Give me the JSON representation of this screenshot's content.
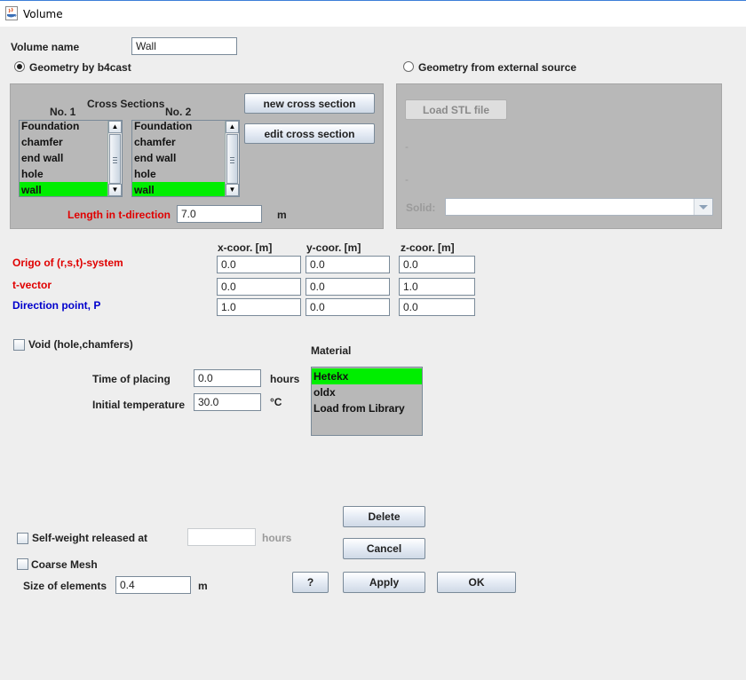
{
  "window": {
    "title": "Volume",
    "icon": "java-coffee-icon"
  },
  "volume_name": {
    "label": "Volume name",
    "value": "Wall"
  },
  "geometry": {
    "b4cast_label": "Geometry by b4cast",
    "external_label": "Geometry from external source",
    "selected": "b4cast"
  },
  "cross_sections": {
    "title": "Cross Sections",
    "list1": {
      "label": "No. 1",
      "items": [
        "Foundation",
        "chamfer",
        "end wall",
        "hole",
        "wall"
      ],
      "selected": 4
    },
    "list2": {
      "label": "No. 2",
      "items": [
        "Foundation",
        "chamfer",
        "end wall",
        "hole",
        "wall"
      ],
      "selected": 4
    },
    "new_button": "new cross section",
    "edit_button": "edit cross section",
    "length_label": "Length in t-direction",
    "length_value": "7.0",
    "length_unit": "m"
  },
  "external": {
    "load_button": "Load STL file",
    "dash1": "-",
    "dash2": "-",
    "solid_label": "Solid:",
    "solid_value": ""
  },
  "coords": {
    "headers": [
      "x-coor. [m]",
      "y-coor. [m]",
      "z-coor. [m]"
    ],
    "rows": [
      {
        "label": "Origo of (r,s,t)-system",
        "color": "#e00000",
        "values": [
          "0.0",
          "0.0",
          "0.0"
        ]
      },
      {
        "label": "t-vector",
        "color": "#e00000",
        "values": [
          "0.0",
          "0.0",
          "1.0"
        ]
      },
      {
        "label": "Direction point, P",
        "color": "#0000cc",
        "values": [
          "1.0",
          "0.0",
          "0.0"
        ]
      }
    ]
  },
  "void": {
    "label": "Void (hole,chamfers)",
    "checked": false
  },
  "time_of_placing": {
    "label": "Time of placing",
    "value": "0.0",
    "unit": "hours"
  },
  "initial_temperature": {
    "label": "Initial temperature",
    "value": "30.0",
    "unit": "°C"
  },
  "material": {
    "title": "Material",
    "items": [
      "Hetekx",
      "oldx",
      "Load from Library"
    ],
    "selected": 0
  },
  "self_weight": {
    "label": "Self-weight released at",
    "value": "",
    "unit": "hours",
    "checked": false
  },
  "coarse_mesh": {
    "label": "Coarse Mesh",
    "checked": false
  },
  "element_size": {
    "label": "Size of elements",
    "value": "0.4",
    "unit": "m"
  },
  "buttons": {
    "delete": "Delete",
    "cancel": "Cancel",
    "help": "?",
    "apply": "Apply",
    "ok": "OK"
  },
  "colors": {
    "selection": "#00ee00",
    "panel": "#b8b8b8",
    "required_label": "#e00000",
    "point_label": "#0000cc"
  }
}
